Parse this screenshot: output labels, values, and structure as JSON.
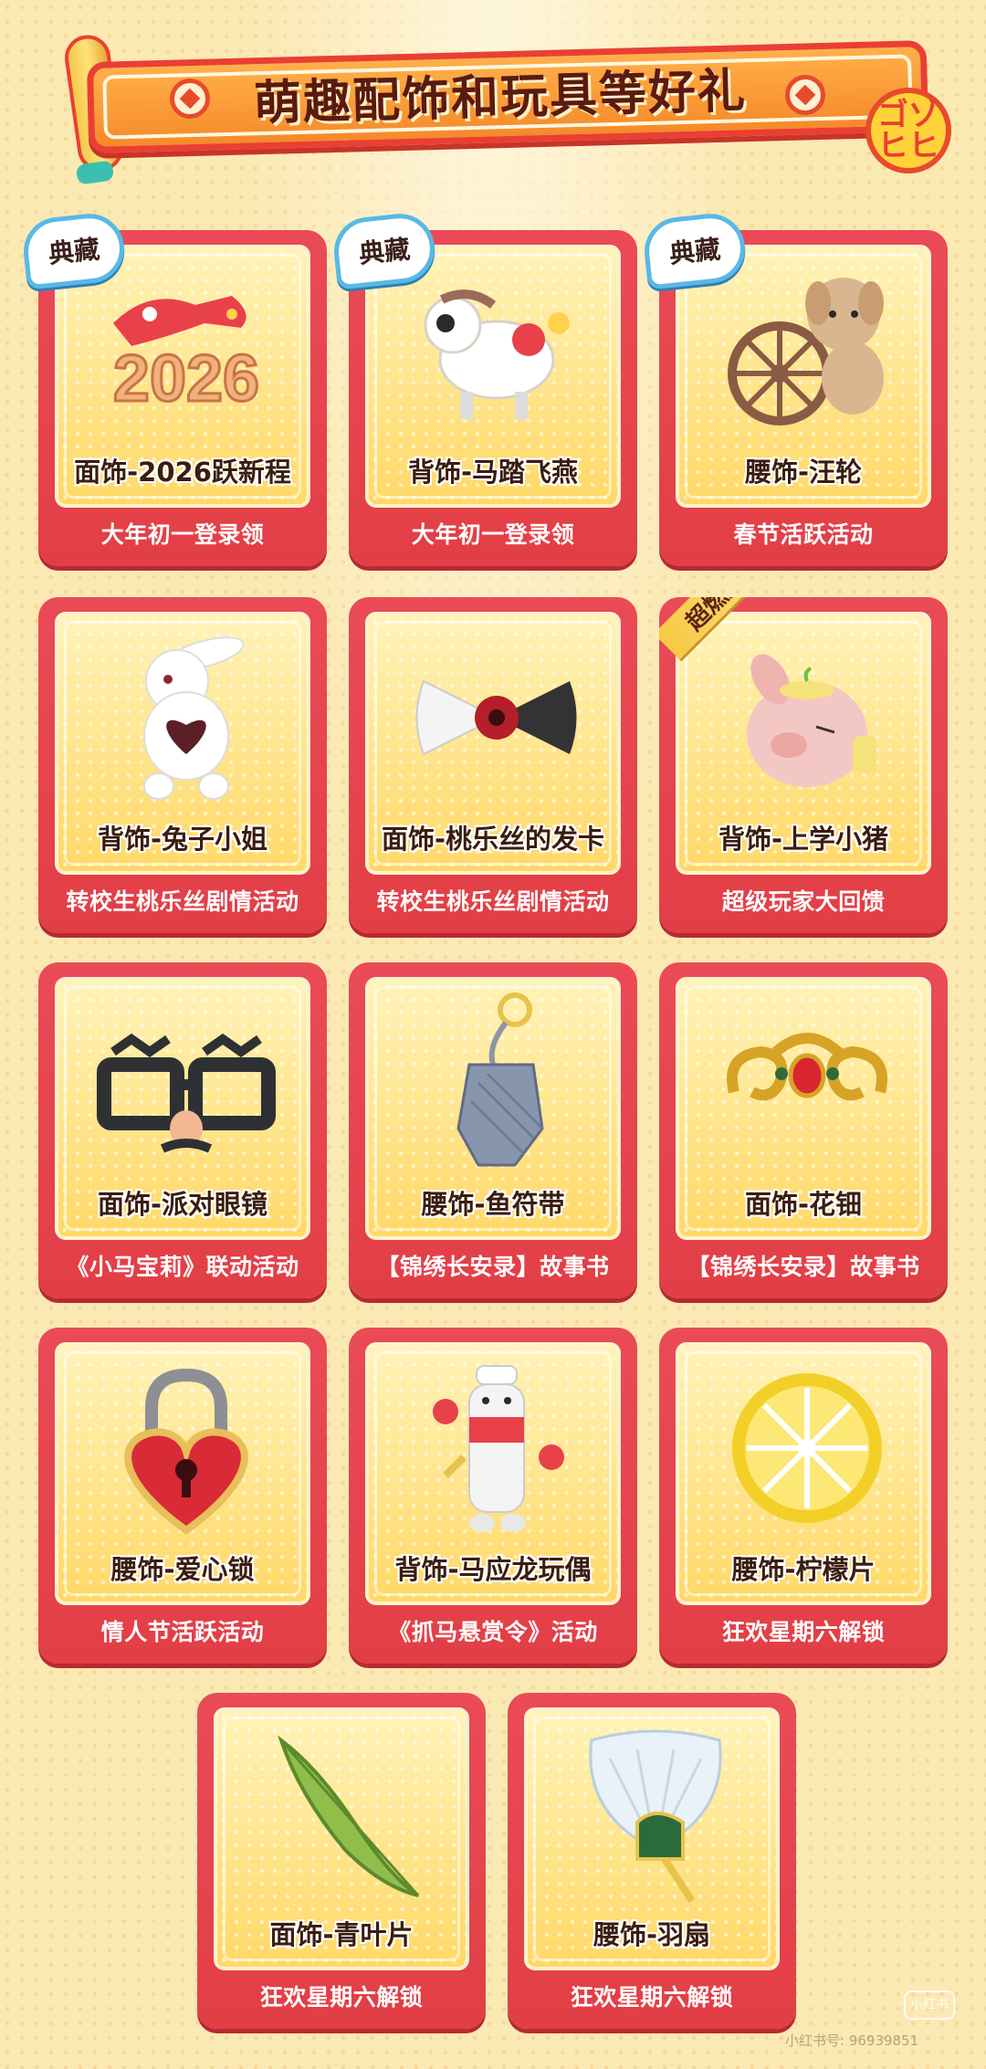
{
  "banner": {
    "title": "萌趣配饰和玩具等好礼",
    "logo_text_top": "ゴゾ",
    "logo_text_bottom": "ヒヒ"
  },
  "badges": {
    "classic": "典藏",
    "hot_weapon": "超燃武器"
  },
  "items": [
    {
      "name": "面饰-2026跃新程",
      "source": "大年初一登录领",
      "icon": "year-2026-horse-icon",
      "badge": "典藏"
    },
    {
      "name": "背饰-马踏飞燕",
      "source": "大年初一登录领",
      "icon": "flying-horse-icon",
      "badge": "典藏"
    },
    {
      "name": "腰饰-汪轮",
      "source": "春节活跃活动",
      "icon": "dog-wheel-icon",
      "badge": "典藏"
    },
    {
      "name": "背饰-兔子小姐",
      "source": "转校生桃乐丝剧情活动",
      "icon": "bunny-plush-icon"
    },
    {
      "name": "面饰-桃乐丝的发卡",
      "source": "转校生桃乐丝剧情活动",
      "icon": "bow-hairclip-icon"
    },
    {
      "name": "背饰-上学小猪",
      "source": "超级玩家大回馈",
      "icon": "pig-icon",
      "ribbon": "超燃武器"
    },
    {
      "name": "面饰-派对眼镜",
      "source": "《小马宝莉》联动活动",
      "icon": "party-glasses-icon"
    },
    {
      "name": "腰饰-鱼符带",
      "source": "【锦绣长安录】故事书",
      "icon": "fish-tally-icon"
    },
    {
      "name": "面饰-花钿",
      "source": "【锦绣长安录】故事书",
      "icon": "gold-ornament-icon"
    },
    {
      "name": "腰饰-爱心锁",
      "source": "情人节活跃活动",
      "icon": "heart-lock-icon"
    },
    {
      "name": "背饰-马应龙玩偶",
      "source": "《抓马悬赏令》活动",
      "icon": "ointment-doll-icon"
    },
    {
      "name": "腰饰-柠檬片",
      "source": "狂欢星期六解锁",
      "icon": "lemon-slice-icon"
    },
    {
      "name": "面饰-青叶片",
      "source": "狂欢星期六解锁",
      "icon": "green-leaf-icon"
    },
    {
      "name": "腰饰-羽扇",
      "source": "狂欢星期六解锁",
      "icon": "feather-fan-icon"
    }
  ],
  "watermark": {
    "text": "小红书号: 96939851",
    "logo": "小红书"
  },
  "colors": {
    "card_red": "#e23e46",
    "card_inner": "#ffe58a",
    "badge_blue": "#58b9e6",
    "background": "#fbe9b4"
  }
}
